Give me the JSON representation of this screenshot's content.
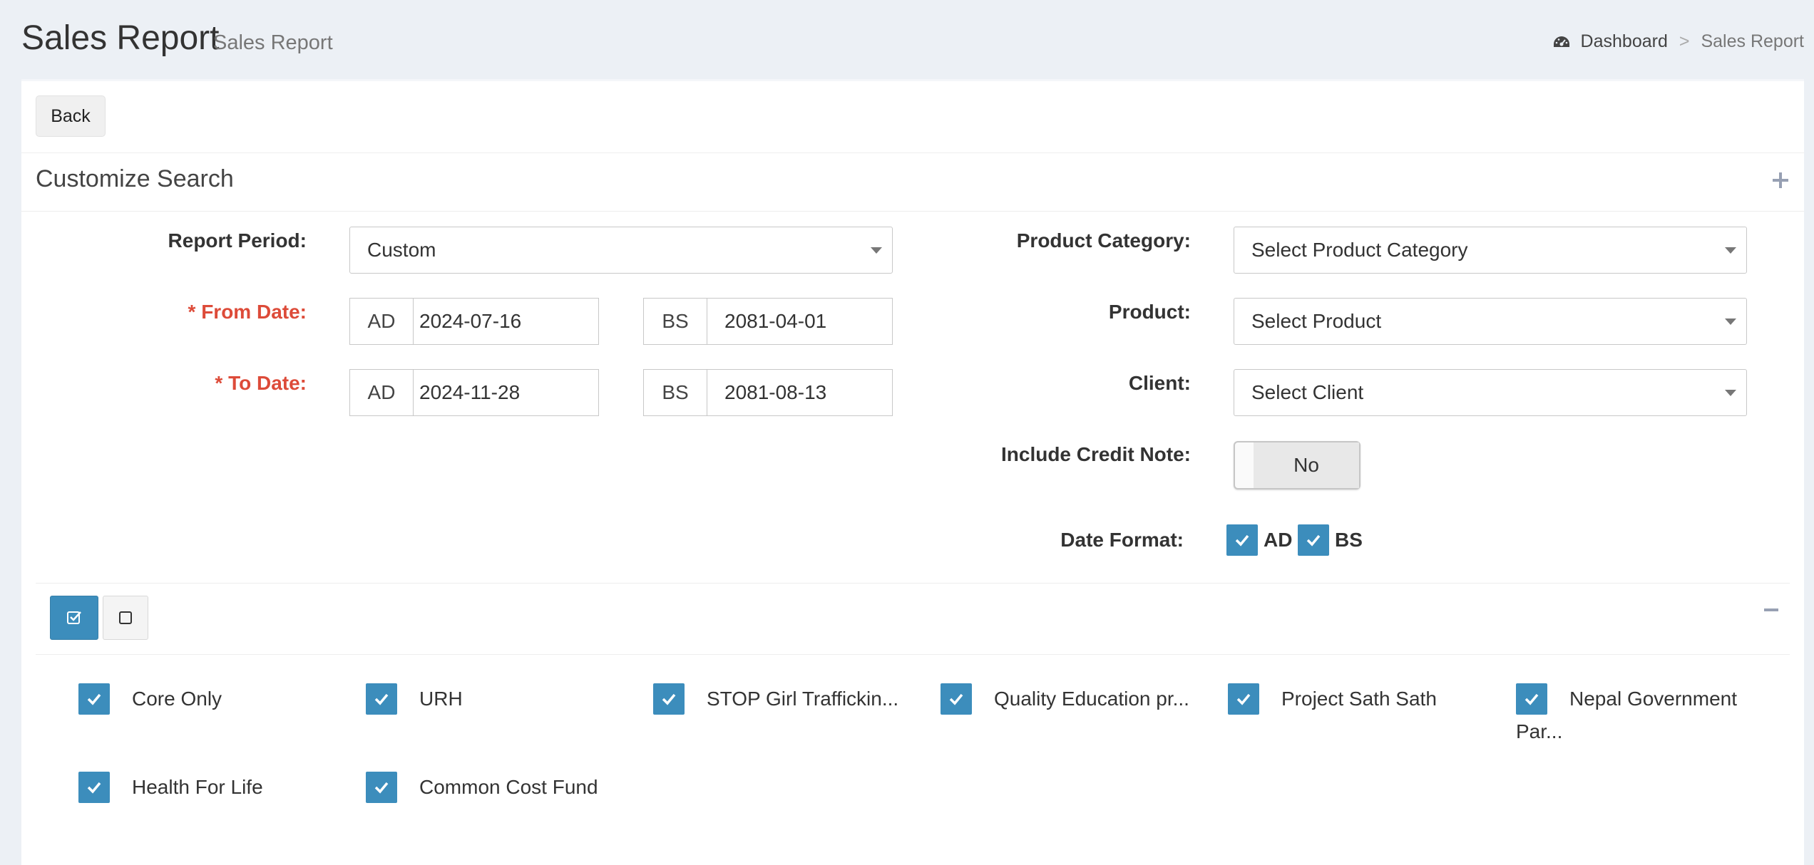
{
  "header": {
    "title": "Sales Report",
    "subtitle": "Sales Report",
    "breadcrumb": {
      "home": "Dashboard",
      "separator": ">",
      "current": "Sales Report"
    }
  },
  "toolbar": {
    "back_label": "Back"
  },
  "customize": {
    "title": "Customize Search",
    "report_period": {
      "label": "Report Period:",
      "value": "Custom"
    },
    "from_date": {
      "label": "* From Date:",
      "ad_addon": "AD",
      "ad_value": "2024-07-16",
      "bs_addon": "BS",
      "bs_value": "2081-04-01"
    },
    "to_date": {
      "label": "* To Date:",
      "ad_addon": "AD",
      "ad_value": "2024-11-28",
      "bs_addon": "BS",
      "bs_value": "2081-08-13"
    },
    "product_category": {
      "label": "Product Category:",
      "placeholder": "Select Product Category"
    },
    "product": {
      "label": "Product:",
      "placeholder": "Select Product"
    },
    "client": {
      "label": "Client:",
      "placeholder": "Select Client"
    },
    "credit_note": {
      "label": "Include Credit Note:",
      "value": "No"
    },
    "date_format": {
      "label": "Date Format:",
      "options": [
        "AD",
        "BS"
      ]
    }
  },
  "projects": {
    "items": [
      "Core Only",
      "URH",
      "STOP Girl Traffickin...",
      "Quality Education pr...",
      "Project Sath Sath",
      "Nepal Government",
      "Health For Life",
      "Common Cost Fund"
    ],
    "item6_continuation": "Par..."
  },
  "colors": {
    "accent": "#3c8dbc",
    "required": "#dd4b39",
    "background": "#ecf0f5"
  }
}
